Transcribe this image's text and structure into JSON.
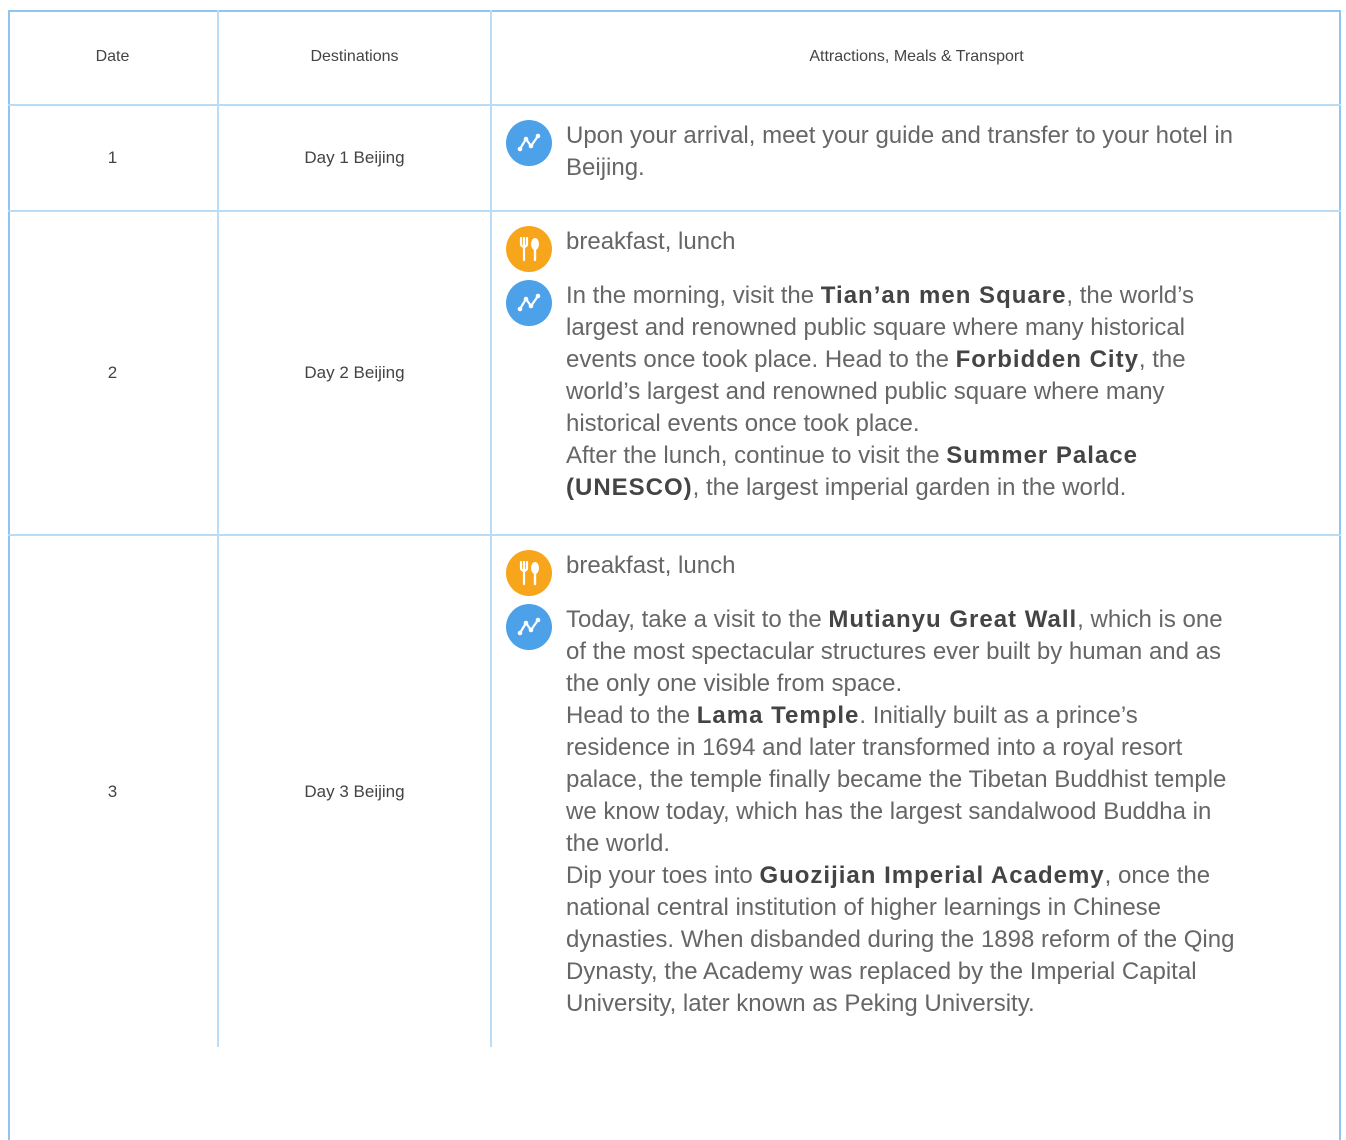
{
  "header": {
    "date": "Date",
    "destinations": "Destinations",
    "details": "Attractions, Meals & Transport"
  },
  "colors": {
    "border": "#8ec5f3",
    "route_icon": "#4da1e9",
    "meal_icon": "#f7a51b"
  },
  "rows": [
    {
      "date": "1",
      "destination": "Day 1 Beijing",
      "items": [
        {
          "icon": "route-icon",
          "parts": [
            {
              "t": "Upon your arrival, meet your guide and transfer to your hotel in Beijing."
            }
          ]
        }
      ]
    },
    {
      "date": "2",
      "destination": "Day 2 Beijing",
      "items": [
        {
          "icon": "meal-icon",
          "parts": [
            {
              "t": "breakfast, lunch"
            }
          ]
        },
        {
          "icon": "route-icon",
          "parts": [
            {
              "t": "In the morning, visit the "
            },
            {
              "t": "Tian’an men Square",
              "b": true
            },
            {
              "t": ", the world’s largest and renowned public square where many historical events once took place. Head to the "
            },
            {
              "t": "Forbidden City",
              "b": true
            },
            {
              "t": ", the world’s largest and renowned public square where many historical events once took place."
            },
            {
              "br": true
            },
            {
              "t": "After the lunch, continue to visit the "
            },
            {
              "t": "Summer Palace (UNESCO)",
              "b": true
            },
            {
              "t": ", the largest imperial garden in the world."
            }
          ]
        }
      ]
    },
    {
      "date": "3",
      "destination": "Day 3 Beijing",
      "items": [
        {
          "icon": "meal-icon",
          "parts": [
            {
              "t": "breakfast, lunch"
            }
          ]
        },
        {
          "icon": "route-icon",
          "parts": [
            {
              "t": "Today, take a visit to the "
            },
            {
              "t": "Mutianyu Great Wall",
              "b": true
            },
            {
              "t": ", which is one of the most spectacular structures ever built by human and as the only one visible from space."
            },
            {
              "br": true
            },
            {
              "t": "Head to the "
            },
            {
              "t": "Lama Temple",
              "b": true
            },
            {
              "t": ". Initially built as a prince’s residence in 1694 and later transformed into a royal resort palace, the temple finally became the Tibetan Buddhist temple we know today, which has the largest sandalwood Buddha in the world."
            },
            {
              "br": true
            },
            {
              "t": "Dip your toes into "
            },
            {
              "t": "Guozijian Imperial Academy",
              "b": true
            },
            {
              "t": ", once the national central institution of higher learnings in Chinese dynasties. When disbanded during the 1898 reform of the Qing Dynasty, the Academy was replaced by the Imperial Capital University, later known as Peking University."
            }
          ]
        }
      ]
    }
  ]
}
